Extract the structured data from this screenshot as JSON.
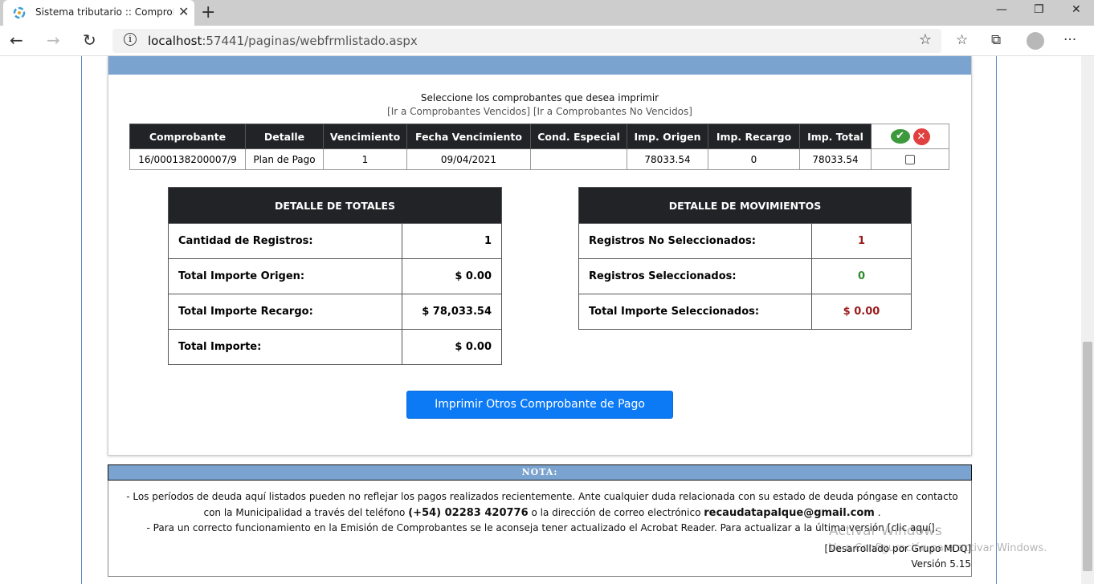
{
  "browser": {
    "tab_title": "Sistema tributario :: Comprobant",
    "url_host": "localhost",
    "url_rest": ":57441/paginas/webfrmlistado.aspx"
  },
  "page": {
    "select_title": "Seleccione los comprobantes que desea imprimir",
    "links": "[Ir a Comprobantes Vencidos] [Ir a Comprobantes No Vencidos]",
    "table": {
      "headers": [
        "Comprobante",
        "Detalle",
        "Vencimiento",
        "Fecha Vencimiento",
        "Cond. Especial",
        "Imp. Origen",
        "Imp. Recargo",
        "Imp. Total"
      ],
      "rows": [
        [
          "16/000138200007/9",
          "Plan de Pago",
          "1",
          "09/04/2021",
          "",
          "78033.54",
          "0",
          "78033.54"
        ]
      ]
    },
    "totales": {
      "title": "DETALLE DE TOTALES",
      "rows": [
        {
          "label": "Cantidad de Registros:",
          "value": "1"
        },
        {
          "label": "Total Importe Origen:",
          "value": "$ 0.00"
        },
        {
          "label": "Total Importe Recargo:",
          "value": "$ 78,033.54"
        },
        {
          "label": "Total Importe:",
          "value": "$ 0.00"
        }
      ]
    },
    "movimientos": {
      "title": "DETALLE DE MOVIMIENTOS",
      "rows": [
        {
          "label": "Registros No Seleccionados:",
          "value": "1",
          "color": "#9b1b1b"
        },
        {
          "label": "Registros Seleccionados:",
          "value": "0",
          "color": "#2e8b2e"
        },
        {
          "label": "Total Importe Seleccionados:",
          "value": "$ 0.00",
          "color": "#9b1b1b"
        }
      ]
    },
    "print_button": "Imprimir Otros Comprobante de Pago",
    "nota": {
      "title": "NOTA:",
      "line1a": "- Los períodos de deuda aquí listados pueden no reflejar los pagos realizados recientemente. Ante cualquier duda relacionada con su estado de deuda  póngase en contacto con la Municipalidad a través del teléfono",
      "phone": "(+54) 02283 420776",
      "line1b": " o la dirección de correo electrónico",
      "email": "recaudatapalque@gmail.com",
      "line1c": ".",
      "line2": "- Para un correcto funcionamiento en la Emisión de Comprobantes se le aconseja tener actualizado el Acrobat Reader. Para actualizar a la última versión [clic aquí]."
    },
    "developer": "[Desarrollado por Grupo MDQ]",
    "version": "Versión 5.15",
    "watermark_title": "Activar Windows",
    "watermark_sub": "Ve a Configuración para activar Windows."
  }
}
